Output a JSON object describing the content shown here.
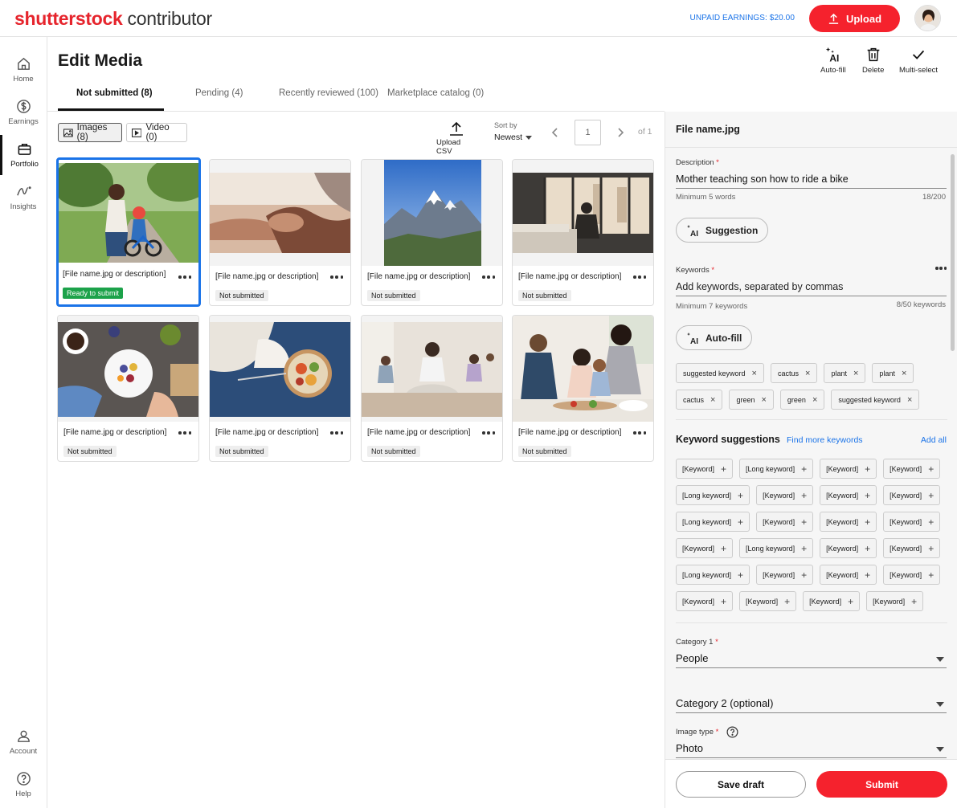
{
  "brand": {
    "name": "shutterstock",
    "product": "contributor"
  },
  "header": {
    "earnings_label": "UNPAID EARNINGS: $20.00",
    "upload_label": "Upload"
  },
  "nav": [
    {
      "label": "Home",
      "icon": "home-icon"
    },
    {
      "label": "Earnings",
      "icon": "dollar-icon"
    },
    {
      "label": "Portfolio",
      "icon": "briefcase-icon",
      "active": true
    },
    {
      "label": "Insights",
      "icon": "insights-icon"
    },
    {
      "label": "Account",
      "icon": "user-icon"
    },
    {
      "label": "Help",
      "icon": "help-icon"
    }
  ],
  "page": {
    "title": "Edit Media"
  },
  "actions": {
    "autofill": "Auto-fill",
    "delete": "Delete",
    "multiselect": "Multi-select"
  },
  "tabs": [
    "Not submitted (8)",
    "Pending (4)",
    "Recently reviewed (100)",
    "Marketplace catalog (0)"
  ],
  "filters": {
    "images": "Images (8)",
    "video": "Video (0)"
  },
  "toolbar": {
    "upload_csv": "Upload CSV",
    "sort_label": "Sort by",
    "sort_value": "Newest",
    "page": "1",
    "page_of": "of 1"
  },
  "cards": [
    {
      "name": "[File name.jpg or description]",
      "status": "Ready to submit",
      "ready": true,
      "scene": "bike"
    },
    {
      "name": "[File name.jpg or description]",
      "status": "Not submitted",
      "scene": "hands"
    },
    {
      "name": "[File name.jpg or description]",
      "status": "Not submitted",
      "scene": "mountain"
    },
    {
      "name": "[File name.jpg or description]",
      "status": "Not submitted",
      "scene": "window"
    },
    {
      "name": "[File name.jpg or description]",
      "status": "Not submitted",
      "scene": "breakfast"
    },
    {
      "name": "[File name.jpg or description]",
      "status": "Not submitted",
      "scene": "bowl"
    },
    {
      "name": "[File name.jpg or description]",
      "status": "Not submitted",
      "scene": "yoga"
    },
    {
      "name": "[File name.jpg or description]",
      "status": "Not submitted",
      "scene": "family"
    }
  ],
  "panel": {
    "filename": "File name.jpg",
    "description_label": "Description",
    "description_value": "Mother teaching son how to ride a bike",
    "description_hint": "Minimum 5 words",
    "description_count": "18/200",
    "suggestion_btn": "Suggestion",
    "keywords_label": "Keywords",
    "keywords_placeholder": "Add keywords, separated by commas",
    "keywords_hint": "Minimum 7 keywords",
    "keywords_count": "8/50 keywords",
    "autofill_btn": "Auto-fill",
    "keywords": [
      "suggested keyword",
      "cactus",
      "plant",
      "plant",
      "cactus",
      "green",
      "green",
      "suggested keyword"
    ],
    "suggestions_title": "Keyword suggestions",
    "find_more": "Find more keywords",
    "add_all": "Add all",
    "suggestions": [
      "[Keyword]",
      "[Long keyword]",
      "[Keyword]",
      "[Keyword]",
      "[Long keyword]",
      "[Keyword]",
      "[Keyword]",
      "[Keyword]",
      "[Long keyword]",
      "[Keyword]",
      "[Keyword]",
      "[Keyword]",
      "[Keyword]",
      "[Long keyword]",
      "[Keyword]",
      "[Keyword]",
      "[Long keyword]",
      "[Keyword]",
      "[Keyword]",
      "[Keyword]",
      "[Keyword]",
      "[Keyword]",
      "[Keyword]",
      "[Keyword]"
    ],
    "category1_label": "Category 1",
    "category1_value": "People",
    "category2_value": "Category 2 (optional)",
    "imagetype_label": "Image type",
    "imagetype_value": "Photo"
  },
  "footer": {
    "save_draft": "Save draft",
    "submit": "Submit"
  },
  "colors": {
    "accent": "#f5222d",
    "link": "#1a73e8",
    "ready": "#1ca24a"
  }
}
